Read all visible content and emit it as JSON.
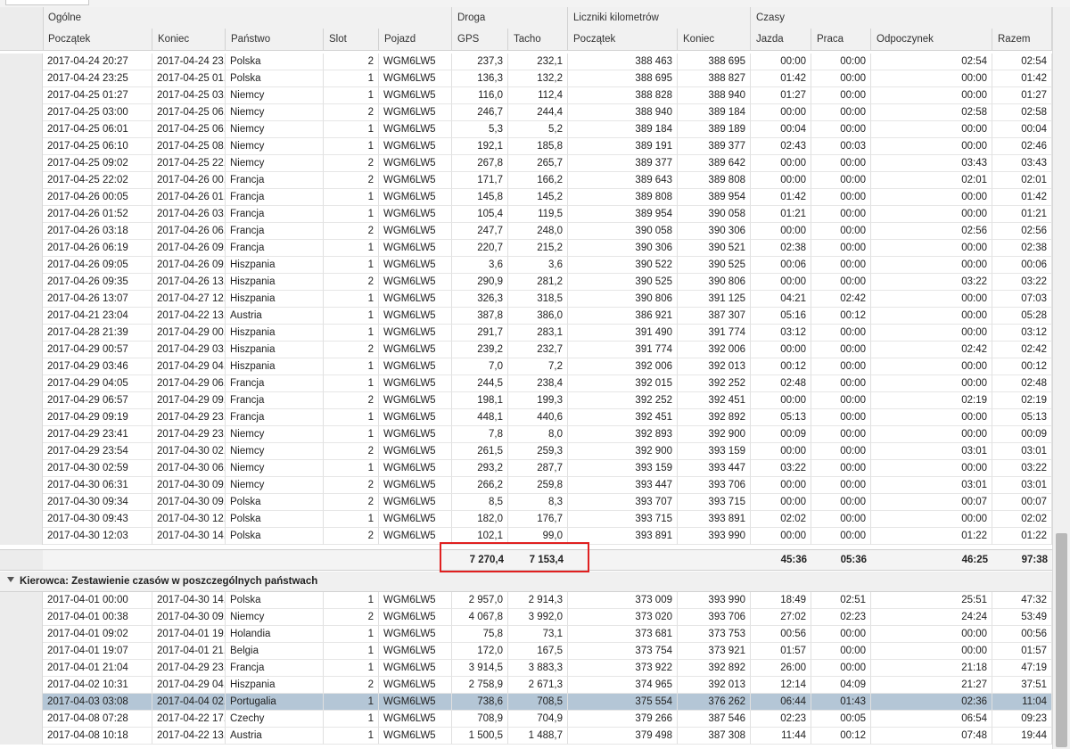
{
  "header": {
    "groups": {
      "general": "Ogólne",
      "distance": "Droga",
      "odometer": "Liczniki kilometrów",
      "times": "Czasy"
    },
    "columns": [
      "Początek",
      "Koniec",
      "Państwo",
      "Slot",
      "Pojazd",
      "GPS",
      "Tacho",
      "Początek",
      "Koniec",
      "Jazda",
      "Praca",
      "Odpoczynek",
      "Razem"
    ]
  },
  "rows": [
    [
      "2017-04-24 20:27",
      "2017-04-24 23...",
      "Polska",
      "2",
      "WGM6LW5",
      "237,3",
      "232,1",
      "388 463",
      "388 695",
      "00:00",
      "00:00",
      "02:54",
      "02:54"
    ],
    [
      "2017-04-24 23:25",
      "2017-04-25 01...",
      "Polska",
      "1",
      "WGM6LW5",
      "136,3",
      "132,2",
      "388 695",
      "388 827",
      "01:42",
      "00:00",
      "00:00",
      "01:42"
    ],
    [
      "2017-04-25 01:27",
      "2017-04-25 03...",
      "Niemcy",
      "1",
      "WGM6LW5",
      "116,0",
      "112,4",
      "388 828",
      "388 940",
      "01:27",
      "00:00",
      "00:00",
      "01:27"
    ],
    [
      "2017-04-25 03:00",
      "2017-04-25 06...",
      "Niemcy",
      "2",
      "WGM6LW5",
      "246,7",
      "244,4",
      "388 940",
      "389 184",
      "00:00",
      "00:00",
      "02:58",
      "02:58"
    ],
    [
      "2017-04-25 06:01",
      "2017-04-25 06...",
      "Niemcy",
      "1",
      "WGM6LW5",
      "5,3",
      "5,2",
      "389 184",
      "389 189",
      "00:04",
      "00:00",
      "00:00",
      "00:04"
    ],
    [
      "2017-04-25 06:10",
      "2017-04-25 08...",
      "Niemcy",
      "1",
      "WGM6LW5",
      "192,1",
      "185,8",
      "389 191",
      "389 377",
      "02:43",
      "00:03",
      "00:00",
      "02:46"
    ],
    [
      "2017-04-25 09:02",
      "2017-04-25 22...",
      "Niemcy",
      "2",
      "WGM6LW5",
      "267,8",
      "265,7",
      "389 377",
      "389 642",
      "00:00",
      "00:00",
      "03:43",
      "03:43"
    ],
    [
      "2017-04-25 22:02",
      "2017-04-26 00...",
      "Francja",
      "2",
      "WGM6LW5",
      "171,7",
      "166,2",
      "389 643",
      "389 808",
      "00:00",
      "00:00",
      "02:01",
      "02:01"
    ],
    [
      "2017-04-26 00:05",
      "2017-04-26 01...",
      "Francja",
      "1",
      "WGM6LW5",
      "145,8",
      "145,2",
      "389 808",
      "389 954",
      "01:42",
      "00:00",
      "00:00",
      "01:42"
    ],
    [
      "2017-04-26 01:52",
      "2017-04-26 03...",
      "Francja",
      "1",
      "WGM6LW5",
      "105,4",
      "119,5",
      "389 954",
      "390 058",
      "01:21",
      "00:00",
      "00:00",
      "01:21"
    ],
    [
      "2017-04-26 03:18",
      "2017-04-26 06...",
      "Francja",
      "2",
      "WGM6LW5",
      "247,7",
      "248,0",
      "390 058",
      "390 306",
      "00:00",
      "00:00",
      "02:56",
      "02:56"
    ],
    [
      "2017-04-26 06:19",
      "2017-04-26 09...",
      "Francja",
      "1",
      "WGM6LW5",
      "220,7",
      "215,2",
      "390 306",
      "390 521",
      "02:38",
      "00:00",
      "00:00",
      "02:38"
    ],
    [
      "2017-04-26 09:05",
      "2017-04-26 09...",
      "Hiszpania",
      "1",
      "WGM6LW5",
      "3,6",
      "3,6",
      "390 522",
      "390 525",
      "00:06",
      "00:00",
      "00:00",
      "00:06"
    ],
    [
      "2017-04-26 09:35",
      "2017-04-26 13...",
      "Hiszpania",
      "2",
      "WGM6LW5",
      "290,9",
      "281,2",
      "390 525",
      "390 806",
      "00:00",
      "00:00",
      "03:22",
      "03:22"
    ],
    [
      "2017-04-26 13:07",
      "2017-04-27 12...",
      "Hiszpania",
      "1",
      "WGM6LW5",
      "326,3",
      "318,5",
      "390 806",
      "391 125",
      "04:21",
      "02:42",
      "00:00",
      "07:03"
    ],
    [
      "2017-04-21 23:04",
      "2017-04-22 13...",
      "Austria",
      "1",
      "WGM6LW5",
      "387,8",
      "386,0",
      "386 921",
      "387 307",
      "05:16",
      "00:12",
      "00:00",
      "05:28"
    ],
    [
      "2017-04-28 21:39",
      "2017-04-29 00...",
      "Hiszpania",
      "1",
      "WGM6LW5",
      "291,7",
      "283,1",
      "391 490",
      "391 774",
      "03:12",
      "00:00",
      "00:00",
      "03:12"
    ],
    [
      "2017-04-29 00:57",
      "2017-04-29 03...",
      "Hiszpania",
      "2",
      "WGM6LW5",
      "239,2",
      "232,7",
      "391 774",
      "392 006",
      "00:00",
      "00:00",
      "02:42",
      "02:42"
    ],
    [
      "2017-04-29 03:46",
      "2017-04-29 04...",
      "Hiszpania",
      "1",
      "WGM6LW5",
      "7,0",
      "7,2",
      "392 006",
      "392 013",
      "00:12",
      "00:00",
      "00:00",
      "00:12"
    ],
    [
      "2017-04-29 04:05",
      "2017-04-29 06...",
      "Francja",
      "1",
      "WGM6LW5",
      "244,5",
      "238,4",
      "392 015",
      "392 252",
      "02:48",
      "00:00",
      "00:00",
      "02:48"
    ],
    [
      "2017-04-29 06:57",
      "2017-04-29 09...",
      "Francja",
      "2",
      "WGM6LW5",
      "198,1",
      "199,3",
      "392 252",
      "392 451",
      "00:00",
      "00:00",
      "02:19",
      "02:19"
    ],
    [
      "2017-04-29 09:19",
      "2017-04-29 23...",
      "Francja",
      "1",
      "WGM6LW5",
      "448,1",
      "440,6",
      "392 451",
      "392 892",
      "05:13",
      "00:00",
      "00:00",
      "05:13"
    ],
    [
      "2017-04-29 23:41",
      "2017-04-29 23...",
      "Niemcy",
      "1",
      "WGM6LW5",
      "7,8",
      "8,0",
      "392 893",
      "392 900",
      "00:09",
      "00:00",
      "00:00",
      "00:09"
    ],
    [
      "2017-04-29 23:54",
      "2017-04-30 02...",
      "Niemcy",
      "2",
      "WGM6LW5",
      "261,5",
      "259,3",
      "392 900",
      "393 159",
      "00:00",
      "00:00",
      "03:01",
      "03:01"
    ],
    [
      "2017-04-30 02:59",
      "2017-04-30 06...",
      "Niemcy",
      "1",
      "WGM6LW5",
      "293,2",
      "287,7",
      "393 159",
      "393 447",
      "03:22",
      "00:00",
      "00:00",
      "03:22"
    ],
    [
      "2017-04-30 06:31",
      "2017-04-30 09...",
      "Niemcy",
      "2",
      "WGM6LW5",
      "266,2",
      "259,8",
      "393 447",
      "393 706",
      "00:00",
      "00:00",
      "03:01",
      "03:01"
    ],
    [
      "2017-04-30 09:34",
      "2017-04-30 09...",
      "Polska",
      "2",
      "WGM6LW5",
      "8,5",
      "8,3",
      "393 707",
      "393 715",
      "00:00",
      "00:00",
      "00:07",
      "00:07"
    ],
    [
      "2017-04-30 09:43",
      "2017-04-30 12...",
      "Polska",
      "1",
      "WGM6LW5",
      "182,0",
      "176,7",
      "393 715",
      "393 891",
      "02:02",
      "00:00",
      "00:00",
      "02:02"
    ],
    [
      "2017-04-30 12:03",
      "2017-04-30 14...",
      "Polska",
      "2",
      "WGM6LW5",
      "102,1",
      "99,0",
      "393 891",
      "393 990",
      "00:00",
      "00:00",
      "01:22",
      "01:22"
    ]
  ],
  "totals": {
    "gps": "7 270,4",
    "tacho": "7 153,4",
    "jazda": "45:36",
    "praca": "05:36",
    "odpoczynek": "46:25",
    "razem": "97:38"
  },
  "group2": {
    "title": "Kierowca: Zestawienie czasów w poszczególnych państwach",
    "selected_index": 6,
    "rows": [
      [
        "2017-04-01 00:00",
        "2017-04-30 14...",
        "Polska",
        "1",
        "WGM6LW5",
        "2 957,0",
        "2 914,3",
        "373 009",
        "393 990",
        "18:49",
        "02:51",
        "25:51",
        "47:32"
      ],
      [
        "2017-04-01 00:38",
        "2017-04-30 09...",
        "Niemcy",
        "2",
        "WGM6LW5",
        "4 067,8",
        "3 992,0",
        "373 020",
        "393 706",
        "27:02",
        "02:23",
        "24:24",
        "53:49"
      ],
      [
        "2017-04-01 09:02",
        "2017-04-01 19...",
        "Holandia",
        "1",
        "WGM6LW5",
        "75,8",
        "73,1",
        "373 681",
        "373 753",
        "00:56",
        "00:00",
        "00:00",
        "00:56"
      ],
      [
        "2017-04-01 19:07",
        "2017-04-01 21...",
        "Belgia",
        "1",
        "WGM6LW5",
        "172,0",
        "167,5",
        "373 754",
        "373 921",
        "01:57",
        "00:00",
        "00:00",
        "01:57"
      ],
      [
        "2017-04-01 21:04",
        "2017-04-29 23...",
        "Francja",
        "1",
        "WGM6LW5",
        "3 914,5",
        "3 883,3",
        "373 922",
        "392 892",
        "26:00",
        "00:00",
        "21:18",
        "47:19"
      ],
      [
        "2017-04-02 10:31",
        "2017-04-29 04...",
        "Hiszpania",
        "2",
        "WGM6LW5",
        "2 758,9",
        "2 671,3",
        "374 965",
        "392 013",
        "12:14",
        "04:09",
        "21:27",
        "37:51"
      ],
      [
        "2017-04-03 03:08",
        "2017-04-04 02...",
        "Portugalia",
        "1",
        "WGM6LW5",
        "738,6",
        "708,5",
        "375 554",
        "376 262",
        "06:44",
        "01:43",
        "02:36",
        "11:04"
      ],
      [
        "2017-04-08 07:28",
        "2017-04-22 17...",
        "Czechy",
        "1",
        "WGM6LW5",
        "708,9",
        "704,9",
        "379 266",
        "387 546",
        "02:23",
        "00:05",
        "06:54",
        "09:23"
      ],
      [
        "2017-04-08 10:18",
        "2017-04-22 13...",
        "Austria",
        "1",
        "WGM6LW5",
        "1 500,5",
        "1 488,7",
        "379 498",
        "387 308",
        "11:44",
        "00:12",
        "07:48",
        "19:44"
      ]
    ]
  }
}
